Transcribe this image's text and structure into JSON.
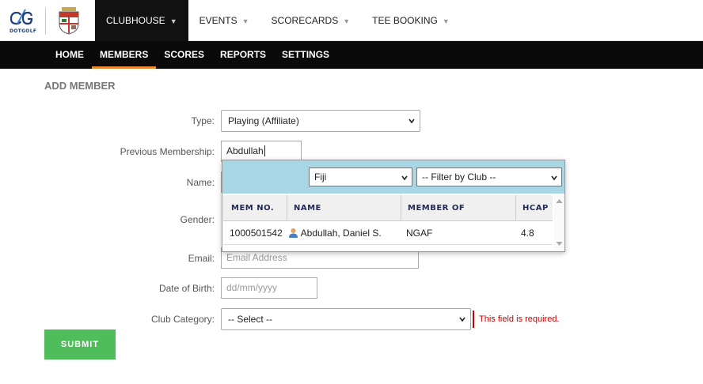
{
  "brand": {
    "logo_text": "DOTGOLF"
  },
  "topnav": [
    {
      "label": "CLUBHOUSE",
      "active": true
    },
    {
      "label": "EVENTS",
      "active": false
    },
    {
      "label": "SCORECARDS",
      "active": false
    },
    {
      "label": "TEE BOOKING",
      "active": false
    }
  ],
  "subnav": [
    {
      "label": "HOME",
      "active": false
    },
    {
      "label": "MEMBERS",
      "active": true
    },
    {
      "label": "SCORES",
      "active": false
    },
    {
      "label": "REPORTS",
      "active": false
    },
    {
      "label": "SETTINGS",
      "active": false
    }
  ],
  "page": {
    "title": "ADD MEMBER"
  },
  "form": {
    "type_label": "Type:",
    "type_value": "Playing (Affiliate)",
    "prev_label": "Previous Membership:",
    "prev_value": "Abdullah",
    "name_label": "Name:",
    "gender_label": "Gender:",
    "email_label": "Email:",
    "email_placeholder": "Email Address",
    "dob_label": "Date of Birth:",
    "dob_placeholder": "dd/mm/yyyy",
    "category_label": "Club Category:",
    "category_value": "-- Select --",
    "category_error": "This field is required.",
    "submit_label": "SUBMIT"
  },
  "popup": {
    "country_value": "Fiji",
    "club_filter_value": "-- Filter by Club --",
    "columns": [
      "MEM NO.",
      "NAME",
      "MEMBER OF",
      "HCAP"
    ],
    "rows": [
      {
        "mem_no": "1000501542",
        "name": "Abdullah, Daniel S.",
        "member_of": "NGAF",
        "hcap": "4.8"
      }
    ]
  },
  "colors": {
    "accent": "#e88a2d",
    "submit": "#4fbe5a",
    "error": "#cc0000",
    "popup_header": "#a9d6e4"
  }
}
